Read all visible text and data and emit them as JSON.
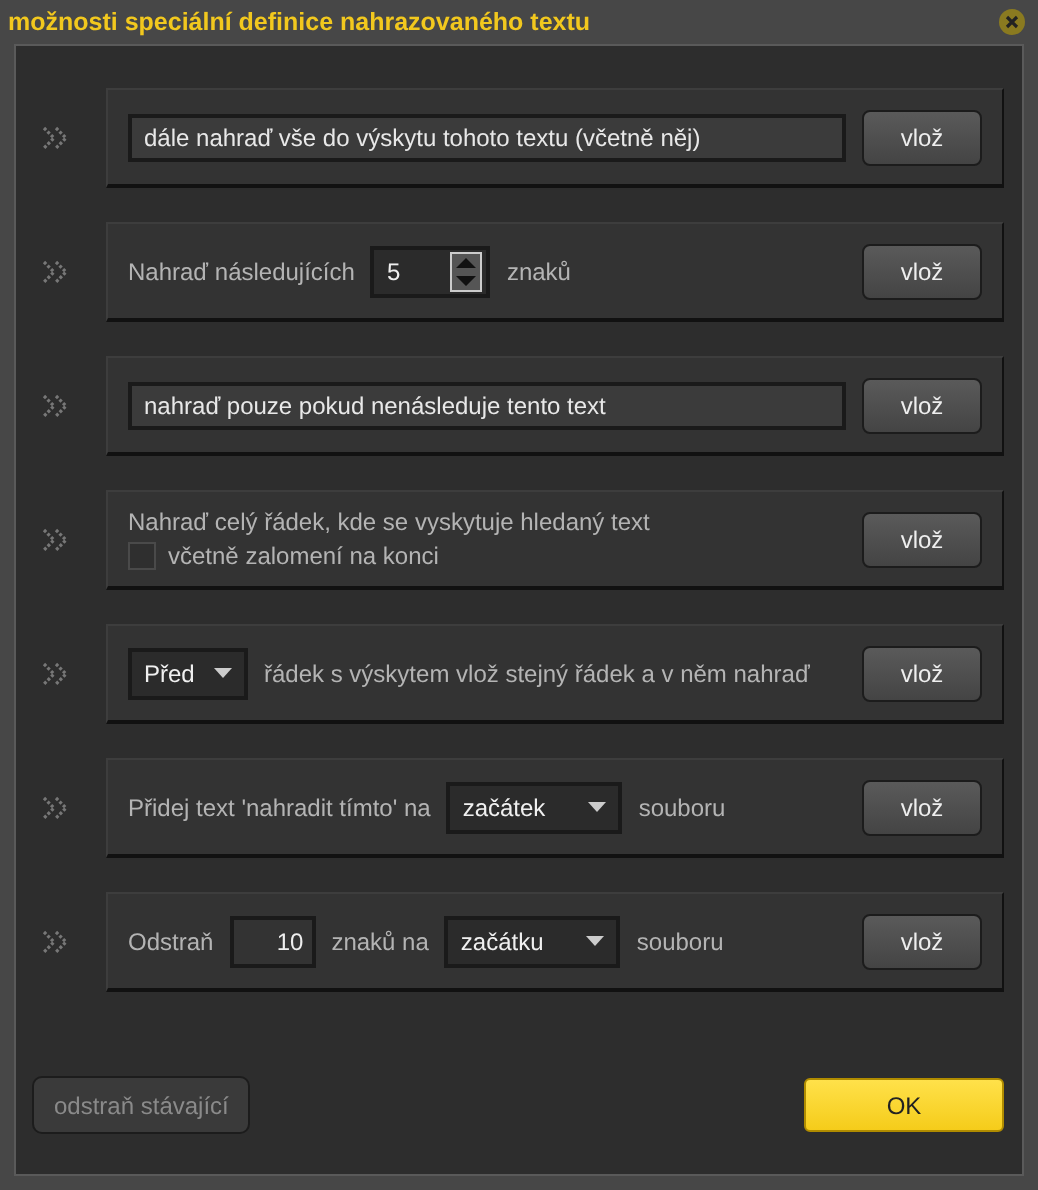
{
  "window": {
    "title": "možnosti speciální definice nahrazovaného textu"
  },
  "rows": [
    {
      "kind": "inline",
      "parts": [
        {
          "kind": "field",
          "value": "dále nahraď vše do výskytu tohoto textu (včetně něj)"
        }
      ],
      "button": "vlož"
    },
    {
      "kind": "inline",
      "parts": [
        {
          "kind": "text",
          "text": "Nahraď následujících"
        },
        {
          "kind": "spinner",
          "value": "5"
        },
        {
          "kind": "text",
          "text": "znaků"
        }
      ],
      "button": "vlož"
    },
    {
      "kind": "inline",
      "parts": [
        {
          "kind": "field",
          "value": "nahraď pouze pokud nenásleduje tento text"
        }
      ],
      "button": "vlož"
    },
    {
      "kind": "stacked",
      "parts": [
        {
          "kind": "text",
          "text": "Nahraď celý řádek, kde se vyskytuje hledaný text"
        },
        {
          "kind": "checkbox",
          "text": "včetně zalomení na konci",
          "checked": false
        }
      ],
      "button": "vlož"
    },
    {
      "kind": "inline",
      "parts": [
        {
          "kind": "select",
          "value": "Před"
        },
        {
          "kind": "text",
          "text": "řádek s výskytem vlož stejný řádek a v něm nahraď"
        }
      ],
      "button": "vlož"
    },
    {
      "kind": "inline",
      "parts": [
        {
          "kind": "text",
          "text": "Přidej text 'nahradit tímto' na"
        },
        {
          "kind": "select",
          "value": "začátek"
        },
        {
          "kind": "text",
          "text": "souboru"
        }
      ],
      "button": "vlož"
    },
    {
      "kind": "inline",
      "parts": [
        {
          "kind": "text",
          "text": "Odstraň"
        },
        {
          "kind": "number",
          "value": "10"
        },
        {
          "kind": "text",
          "text": "znaků na"
        },
        {
          "kind": "select",
          "value": "začátku"
        },
        {
          "kind": "text",
          "text": "souboru"
        }
      ],
      "button": "vlož"
    }
  ],
  "footer": {
    "remove_button": {
      "label": "odstraň stávající",
      "disabled": true
    },
    "ok_button": "OK"
  }
}
